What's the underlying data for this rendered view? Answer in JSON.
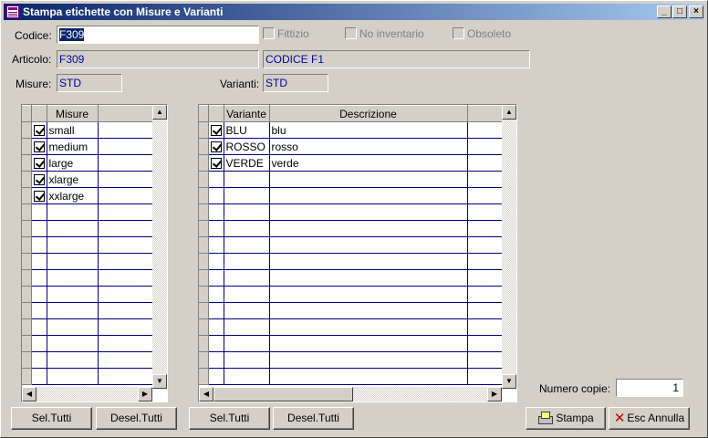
{
  "window": {
    "title": "Stampa etichette con Misure e Varianti"
  },
  "titlebar_buttons": {
    "minimize": "_",
    "maximize": "□",
    "close": "×"
  },
  "form": {
    "codice_label": "Codice:",
    "codice_value": "F309",
    "fittizio_label": "Fittizio",
    "no_inventario_label": "No inventario",
    "obsoleto_label": "Obsoleto",
    "articolo_label": "Articolo:",
    "articolo_code": "F309",
    "articolo_desc": "CODICE F1",
    "misure_label": "Misure:",
    "misure_value": "STD",
    "varianti_label": "Varianti:",
    "varianti_value": "STD"
  },
  "misure_grid": {
    "header": "Misure",
    "rows": [
      {
        "checked": true,
        "label": "small"
      },
      {
        "checked": true,
        "label": "medium"
      },
      {
        "checked": true,
        "label": "large"
      },
      {
        "checked": true,
        "label": "xlarge"
      },
      {
        "checked": true,
        "label": "xxlarge"
      }
    ]
  },
  "varianti_grid": {
    "header_variante": "Variante",
    "header_descrizione": "Descrizione",
    "rows": [
      {
        "checked": true,
        "variante": "BLU",
        "descrizione": "blu"
      },
      {
        "checked": true,
        "variante": "ROSSO",
        "descrizione": "rosso"
      },
      {
        "checked": true,
        "variante": "VERDE",
        "descrizione": "verde"
      }
    ]
  },
  "numero_copie": {
    "label": "Numero copie:",
    "value": "1"
  },
  "buttons": {
    "sel_tutti": "Sel.Tutti",
    "desel_tutti": "Desel.Tutti",
    "stampa": "Stampa",
    "annulla": "Esc Annulla"
  }
}
